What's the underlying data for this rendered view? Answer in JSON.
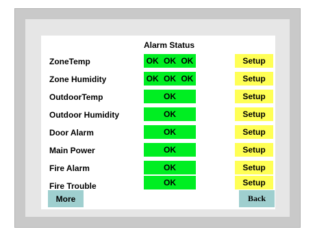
{
  "screen": {
    "title": "Alarm Status"
  },
  "rows": [
    {
      "label": "ZoneTemp",
      "status": "OK  OK  OK",
      "setup": "Setup"
    },
    {
      "label": "Zone Humidity",
      "status": "OK  OK  OK",
      "setup": "Setup"
    },
    {
      "label": "OutdoorTemp",
      "status": "OK",
      "setup": "Setup"
    },
    {
      "label": "Outdoor Humidity",
      "status": "OK",
      "setup": "Setup"
    },
    {
      "label": "Door Alarm",
      "status": "OK",
      "setup": "Setup"
    },
    {
      "label": "Main Power",
      "status": "OK",
      "setup": "Setup"
    },
    {
      "label": "Fire Alarm",
      "status": "OK",
      "setup": "Setup"
    },
    {
      "label": "Fire Trouble",
      "status": "OK",
      "setup": "Setup"
    }
  ],
  "nav": {
    "more_label": "More",
    "back_label": "Back"
  },
  "colors": {
    "ok": "#00ee22",
    "setup": "#ffff55",
    "nav": "#9fcfcf",
    "bezel": "#c9c9c9",
    "frame": "#e6e6e6"
  }
}
